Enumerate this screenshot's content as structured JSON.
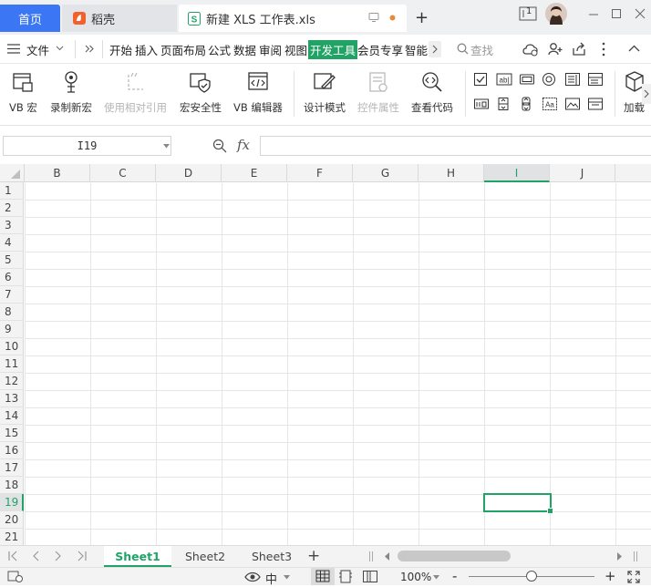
{
  "titlebar": {
    "home_tab": "首页",
    "daoke_tab": "稻壳",
    "doc_tab": "新建 XLS 工作表.xls",
    "new_tab": "+",
    "page_indicator": "1"
  },
  "menu": {
    "file": "文件",
    "items": [
      "开始",
      "插入",
      "页面布局",
      "公式",
      "数据",
      "审阅",
      "视图"
    ],
    "active": "开发工具",
    "more_items": [
      "会员专享",
      "智能"
    ],
    "search": "查找"
  },
  "ribbon": {
    "vb_macro": "VB 宏",
    "record_macro": "录制新宏",
    "relative_ref": "使用相对引用",
    "macro_security": "宏安全性",
    "vb_editor": "VB 编辑器",
    "design_mode": "设计模式",
    "control_props": "控件属性",
    "view_code": "查看代码",
    "addin": "加载"
  },
  "formula": {
    "namebox": "I19",
    "fx": "fx",
    "content": ""
  },
  "grid": {
    "columns": [
      "B",
      "C",
      "D",
      "E",
      "F",
      "G",
      "H",
      "I",
      "J"
    ],
    "selected_column": "I",
    "rows": [
      "1",
      "2",
      "3",
      "4",
      "5",
      "6",
      "7",
      "8",
      "9",
      "10",
      "11",
      "12",
      "13",
      "14",
      "15",
      "16",
      "17",
      "18",
      "19",
      "20",
      "21"
    ],
    "selected_row": "19"
  },
  "sheets": {
    "tabs": [
      "Sheet1",
      "Sheet2",
      "Sheet3"
    ],
    "active": "Sheet1",
    "add": "+"
  },
  "status": {
    "zoom": "100%",
    "zoom_minus": "-",
    "zoom_plus": "+",
    "input_mode": "中",
    "zoom_level": 0.5
  },
  "colors": {
    "accent": "#21a366",
    "home_tab": "#3b76f4"
  }
}
